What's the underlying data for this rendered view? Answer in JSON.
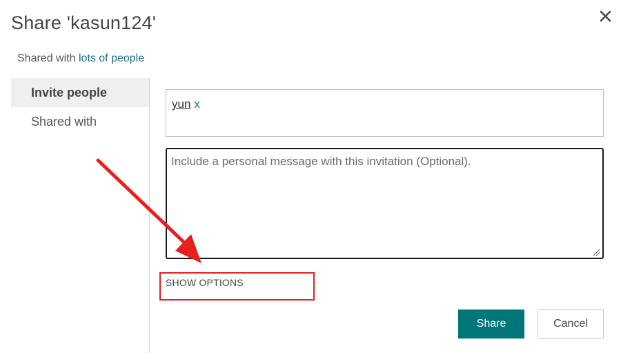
{
  "dialog": {
    "title": "Share 'kasun124'",
    "shared_prefix": "Shared with ",
    "shared_link": "lots of people"
  },
  "nav": {
    "items": [
      {
        "label": "Invite people",
        "active": true
      },
      {
        "label": "Shared with",
        "active": false
      }
    ]
  },
  "invite": {
    "person": "yun",
    "remove": "x",
    "message_placeholder": "Include a personal message with this invitation (Optional)."
  },
  "options": {
    "label": "SHOW OPTIONS"
  },
  "actions": {
    "share": "Share",
    "cancel": "Cancel"
  },
  "icons": {
    "close": "close-icon",
    "resize": "resize-grip-icon"
  },
  "colors": {
    "primary": "#00767a",
    "link": "#1a6e8a",
    "annotation": "#e02020"
  }
}
